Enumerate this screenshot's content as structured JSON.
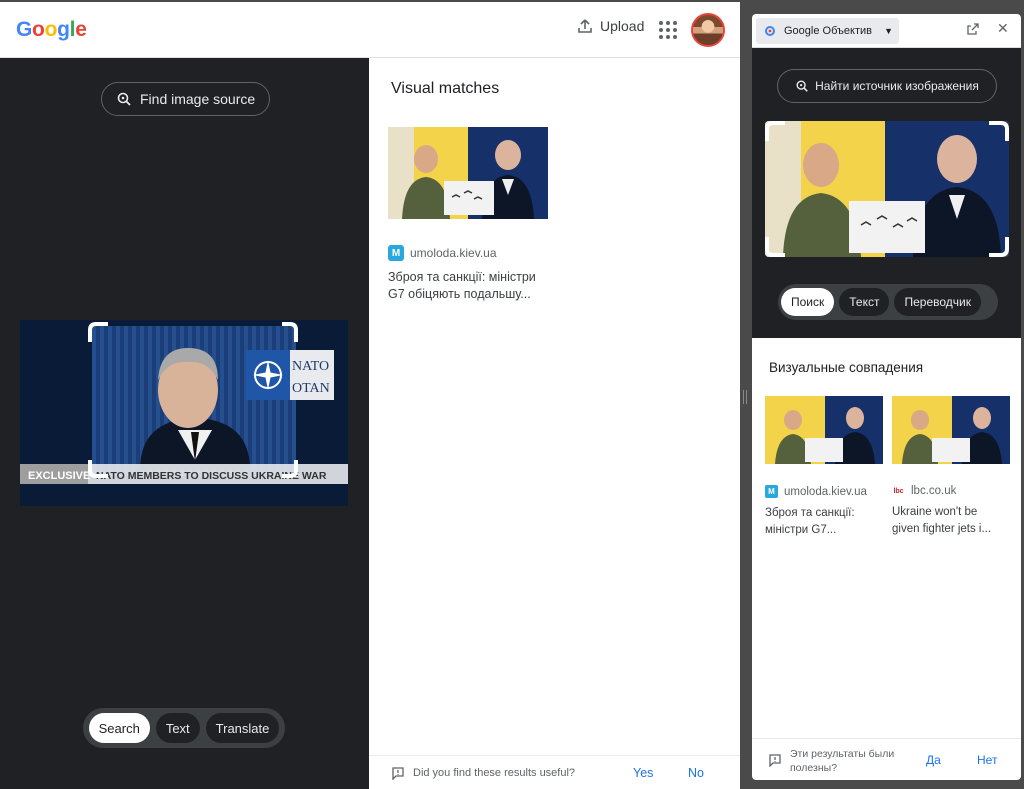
{
  "main": {
    "logo": [
      "G",
      "o",
      "o",
      "g",
      "l",
      "e"
    ],
    "logo_colors": [
      "#4285F4",
      "#EA4335",
      "#FBBC05",
      "#4285F4",
      "#34A853",
      "#EA4335"
    ],
    "upload_label": "Upload",
    "find_source_label": "Find image source",
    "video_overlay": {
      "exclusive": "EXCLUSIVE",
      "headline": "NATO MEMBERS TO DISCUSS UKRAINE WAR",
      "nato_line1": "NATO",
      "nato_line2": "OTAN"
    },
    "modes": [
      {
        "label": "Search",
        "active": true
      },
      {
        "label": "Text",
        "active": false
      },
      {
        "label": "Translate",
        "active": false
      }
    ],
    "visual_matches_title": "Visual matches",
    "results": [
      {
        "source": "umoloda.kiev.ua",
        "title": "Зброя та санкції: міністри G7 обіцяють подальшу..."
      }
    ],
    "feedback": {
      "question": "Did you find these results useful?",
      "yes": "Yes",
      "no": "No"
    }
  },
  "panel": {
    "tab_label": "Google Объектив",
    "find_source_label": "Найти источник изображения",
    "modes": [
      {
        "label": "Поиск",
        "active": true
      },
      {
        "label": "Текст",
        "active": false
      },
      {
        "label": "Переводчик",
        "active": false
      }
    ],
    "visual_matches_title": "Визуальные совпадения",
    "results": [
      {
        "source": "umoloda.kiev.ua",
        "title_line1": "Зброя та санкції:",
        "title_line2": "міністри G7..."
      },
      {
        "source": "lbc.co.uk",
        "title_line1": "Ukraine won't be",
        "title_line2": "given fighter jets i..."
      }
    ],
    "feedback": {
      "question": "Эти результаты были полезны?",
      "yes": "Да",
      "no": "Нет"
    }
  },
  "colors": {
    "accent": "#1a73e8",
    "dark_bg": "#202124",
    "favicon": "#29a8e0"
  },
  "icons": [
    "upload-icon",
    "apps-grid-icon",
    "lens-search-icon",
    "feedback-icon",
    "open-in-new-icon",
    "close-icon",
    "dropdown-caret-icon"
  ]
}
